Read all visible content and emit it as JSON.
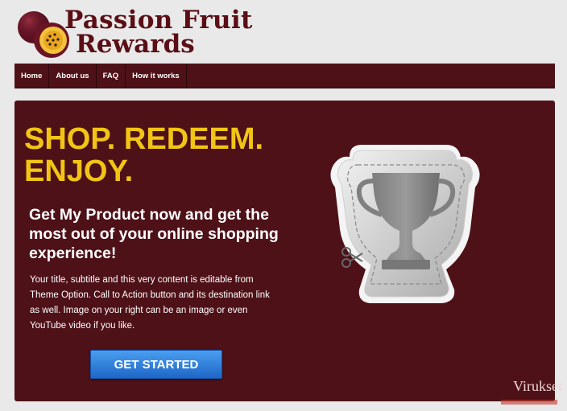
{
  "brand": {
    "line1": "Passion Fruit",
    "line2": "Rewards",
    "color": "#5a0f16"
  },
  "nav": {
    "items": [
      {
        "label": "Home"
      },
      {
        "label": "About us"
      },
      {
        "label": "FAQ"
      },
      {
        "label": "How it works"
      }
    ],
    "background": "#4e1118"
  },
  "hero": {
    "headline_line1": "SHOP. REDEEM.",
    "headline_line2": "ENJOY.",
    "subheadline": "Get My Product now and get the most out of your online shopping experience!",
    "body": "Your title, subtitle and this very content is editable from Theme Option. Call to Action button and its destination link as well. Image on your right can be an image or even YouTube video if you like.",
    "cta_label": "GET STARTED",
    "headline_color": "#f2c515",
    "cta_color": "#2f7fe0",
    "image_icon": "trophy-coupon-icon"
  },
  "watermark": {
    "text": "Virukset"
  }
}
